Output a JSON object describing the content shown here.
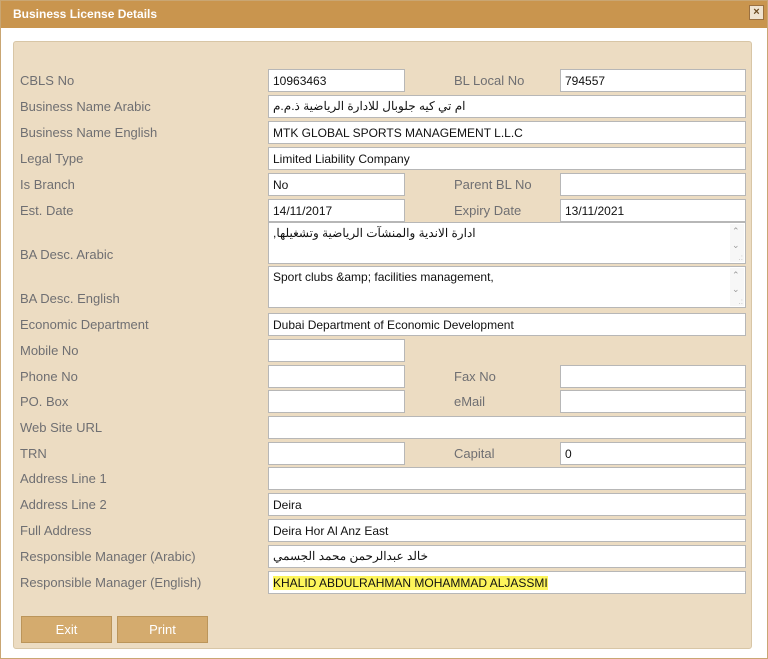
{
  "dialog": {
    "title": "Business License Details",
    "close_glyph": "×"
  },
  "labels": {
    "cbls_no": "CBLS No",
    "bl_local_no": "BL Local No",
    "business_name_arabic": "Business Name Arabic",
    "business_name_english": "Business Name English",
    "legal_type": "Legal Type",
    "is_branch": "Is Branch",
    "parent_bl_no": "Parent BL No",
    "est_date": "Est. Date",
    "expiry_date": "Expiry Date",
    "ba_desc_arabic": "BA Desc. Arabic",
    "ba_desc_english": "BA Desc. English",
    "economic_department": "Economic Department",
    "mobile_no": "Mobile No",
    "phone_no": "Phone No",
    "fax_no": "Fax No",
    "po_box": "PO. Box",
    "email": "eMail",
    "web_site_url": "Web Site URL",
    "trn": "TRN",
    "capital": "Capital",
    "address_line_1": "Address Line 1",
    "address_line_2": "Address Line 2",
    "full_address": "Full Address",
    "responsible_manager_arabic": "Responsible Manager (Arabic)",
    "responsible_manager_english": "Responsible Manager (English)"
  },
  "values": {
    "cbls_no": "10963463",
    "bl_local_no": "794557",
    "business_name_arabic": "ام تي كيه جلوبال للادارة الرياضية ذ.م.م",
    "business_name_english": "MTK GLOBAL SPORTS MANAGEMENT L.L.C",
    "legal_type": "Limited Liability Company",
    "is_branch": "No",
    "parent_bl_no": "",
    "est_date": "14/11/2017",
    "expiry_date": "13/11/2021",
    "ba_desc_arabic": "ادارة الاندية والمنشآت الرياضية وتشغيلها,",
    "ba_desc_english": "Sport clubs &amp; facilities management,",
    "economic_department": "Dubai Department of Economic Development",
    "mobile_no": "",
    "phone_no": "",
    "fax_no": "",
    "po_box": "",
    "email": "",
    "web_site_url": "",
    "trn": "",
    "capital": "0",
    "address_line_1": "",
    "address_line_2": "Deira",
    "full_address": "Deira Hor Al Anz East",
    "responsible_manager_arabic": "خالد عبدالرحمن محمد الجسمي",
    "responsible_manager_english": "KHALID ABDULRAHMAN MOHAMMAD ALJASSMI"
  },
  "buttons": {
    "exit": "Exit",
    "print": "Print"
  },
  "colors": {
    "titlebar": "#c9954e",
    "panel": "#ecdcc2",
    "button": "#d4ab6e",
    "highlight": "#fdf55b"
  }
}
